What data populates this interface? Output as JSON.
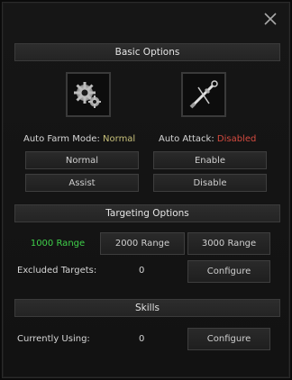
{
  "basic": {
    "header": "Basic Options",
    "farm_mode_label": "Auto Farm Mode:",
    "farm_mode_value": "Normal",
    "attack_label": "Auto Attack:",
    "attack_value": "Disabled",
    "normal_btn": "Normal",
    "assist_btn": "Assist",
    "enable_btn": "Enable",
    "disable_btn": "Disable",
    "farm_icon": "gears-icon",
    "attack_icon": "sword-icon"
  },
  "targeting": {
    "header": "Targeting Options",
    "ranges": [
      "1000 Range",
      "2000 Range",
      "3000 Range"
    ],
    "selected_range": "1000 Range",
    "excluded_label": "Excluded Targets:",
    "excluded_count": "0",
    "configure_btn": "Configure"
  },
  "skills": {
    "header": "Skills",
    "using_label": "Currently Using:",
    "using_count": "0",
    "configure_btn": "Configure"
  },
  "colors": {
    "accent_value": "#c7c07a",
    "disabled": "#d44a3f",
    "selected": "#3fd04a"
  }
}
